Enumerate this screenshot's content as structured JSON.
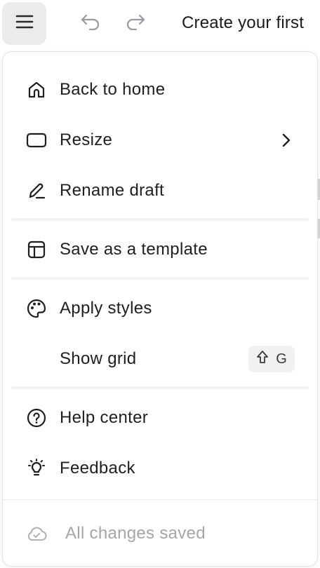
{
  "header": {
    "document_title": "Create your first",
    "icons": {
      "menu": "hamburger-icon",
      "undo": "undo-icon",
      "redo": "redo-icon"
    }
  },
  "menu": {
    "items": [
      {
        "label": "Back to home",
        "icon": "home-icon"
      },
      {
        "label": "Resize",
        "icon": "rectangle-icon",
        "has_submenu": true
      },
      {
        "label": "Rename draft",
        "icon": "pencil-icon"
      },
      {
        "label": "Save as a template",
        "icon": "template-icon"
      },
      {
        "label": "Apply styles",
        "icon": "palette-icon"
      },
      {
        "label": "Show grid",
        "shortcut_key": "G",
        "shortcut_modifier": "shift-icon"
      },
      {
        "label": "Help center",
        "icon": "help-circle-icon"
      },
      {
        "label": "Feedback",
        "icon": "lightbulb-icon"
      }
    ],
    "status": {
      "label": "All changes saved",
      "icon": "cloud-check-icon"
    }
  },
  "colors": {
    "accent_bg": "#ebebeb",
    "text": "#1f1f23",
    "muted": "#a6a6aa"
  }
}
